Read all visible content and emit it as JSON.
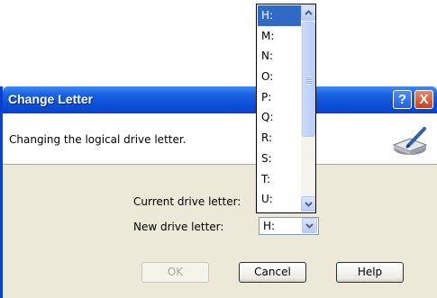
{
  "dialog": {
    "title": "Change Letter",
    "header_text": "Changing the logical drive letter.",
    "current_label": "Current drive letter:",
    "new_label": "New drive letter:",
    "combo_value": "H:",
    "buttons": {
      "ok": "OK",
      "cancel": "Cancel",
      "help": "Help"
    },
    "titlebar_help": "?",
    "titlebar_close": "X"
  },
  "dropdown": {
    "items": [
      "H:",
      "M:",
      "N:",
      "O:",
      "P:",
      "Q:",
      "R:",
      "S:",
      "T:",
      "U:"
    ],
    "selected": "H:"
  },
  "colors": {
    "titlebar": "#0a4ed8",
    "dialog_bg": "#ece9d8",
    "selection": "#316ac5",
    "close_button": "#c8401a"
  },
  "icons": [
    "help-icon",
    "close-icon",
    "drive-pen-icon",
    "scroll-up-icon",
    "scroll-down-icon",
    "combo-arrow-icon"
  ]
}
